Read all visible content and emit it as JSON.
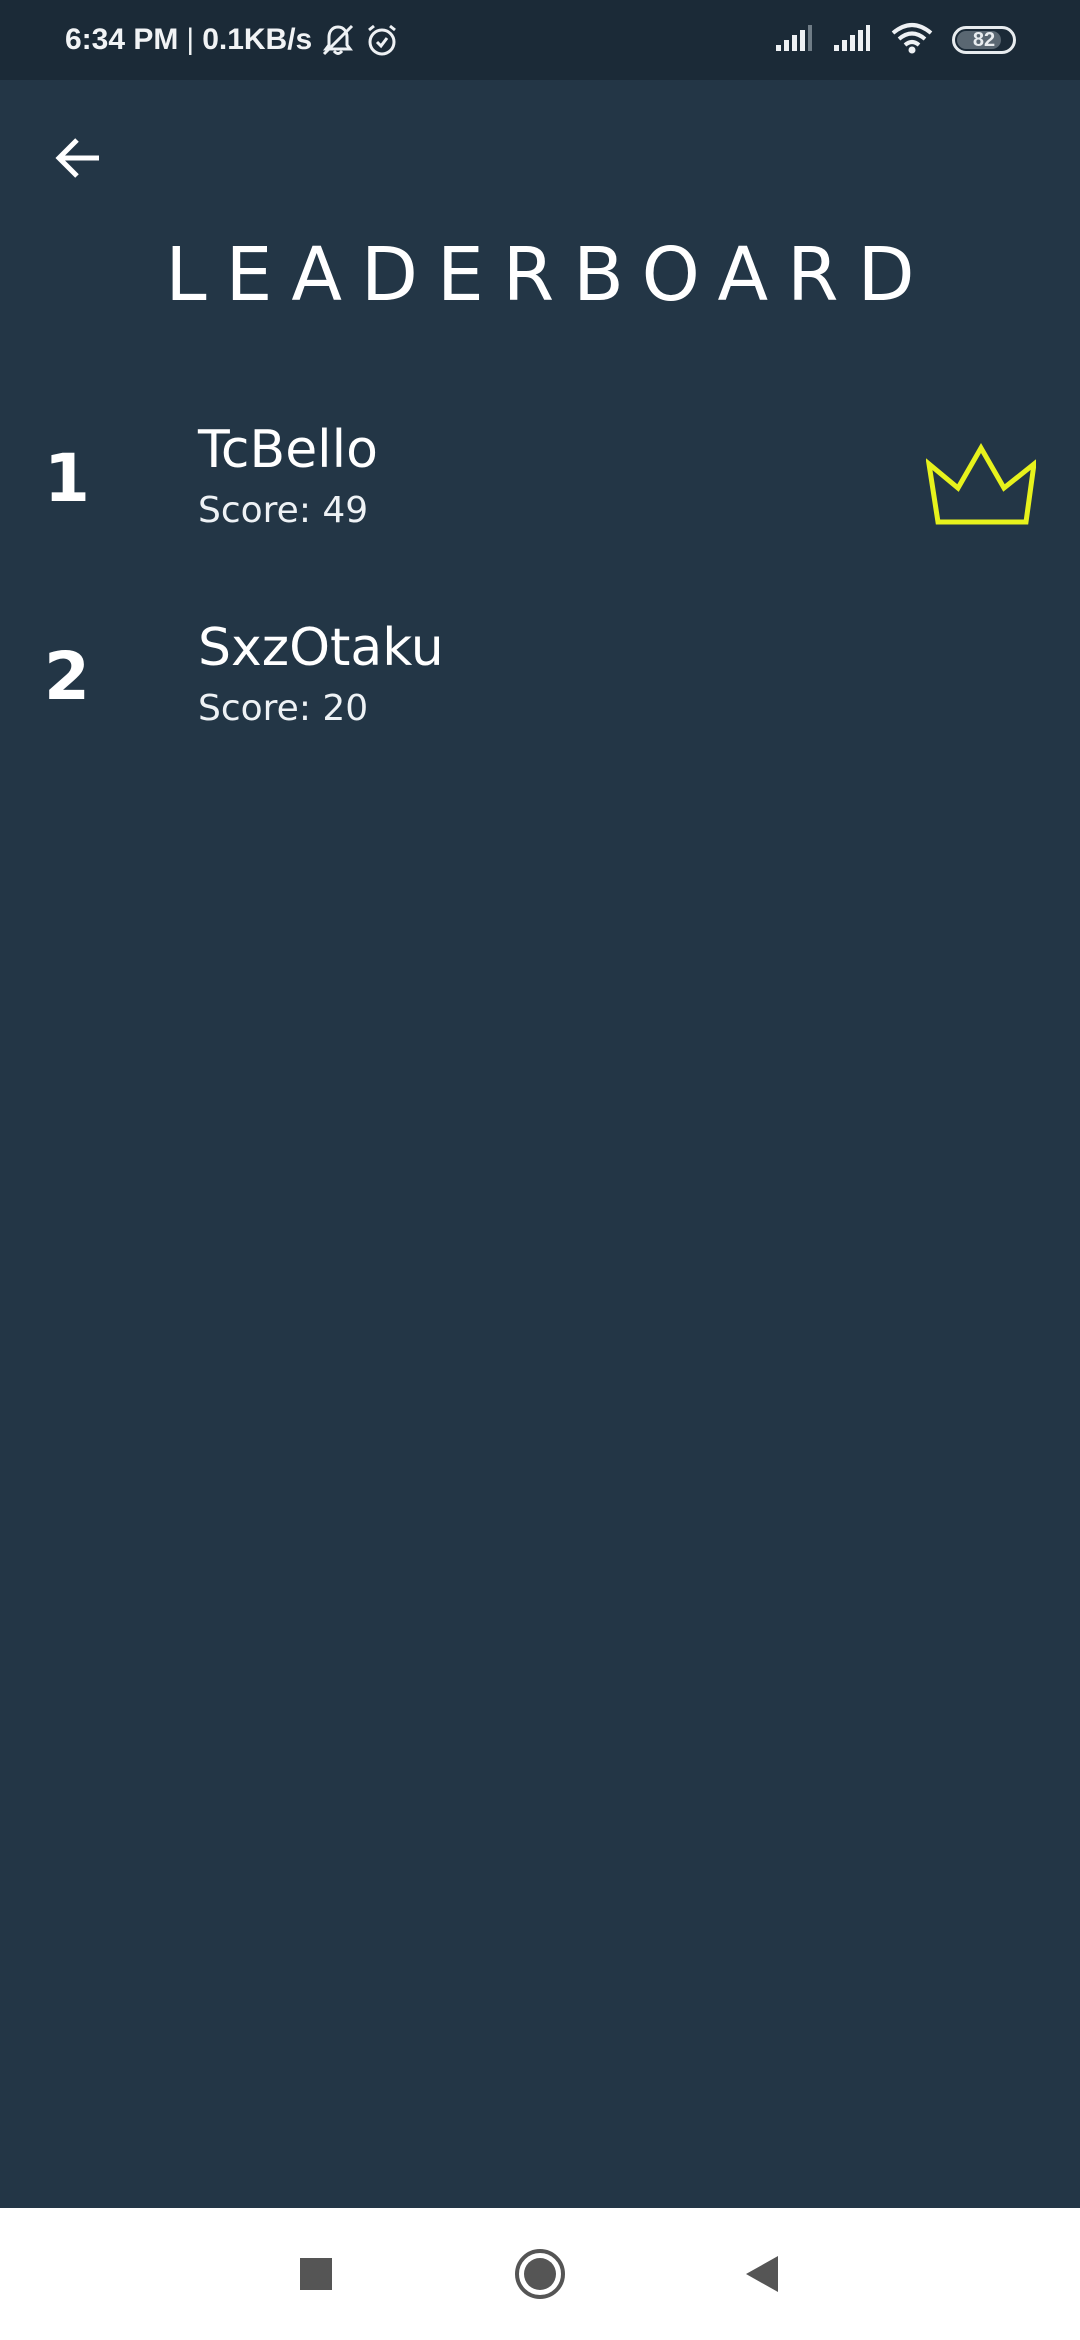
{
  "status_bar": {
    "time": "6:34 PM",
    "separator": "|",
    "network_speed": "0.1KB/s",
    "battery_level": "82",
    "battery_fraction": 0.82,
    "icons": [
      "bell-muted-icon",
      "alarm-icon",
      "signal-icon",
      "signal-icon",
      "wifi-icon",
      "battery-icon"
    ]
  },
  "header": {
    "back_icon": "arrow-left-icon",
    "title": "LEADERBOARD"
  },
  "leaderboard": {
    "entries": [
      {
        "rank": "1",
        "name": "TcBello",
        "score": "Score: 49",
        "badge_icon": "crown-icon"
      },
      {
        "rank": "2",
        "name": "SxzOtaku",
        "score": "Score: 20"
      }
    ]
  },
  "nav_bar": {
    "buttons": [
      "recents-square-icon",
      "home-circle-icon",
      "back-triangle-icon"
    ]
  },
  "colors": {
    "background": "#233646",
    "status_bar": "#1b2a37",
    "text": "#ffffff",
    "crown": "#e7f21c",
    "nav_bar": "#ffffff",
    "nav_icons": "#555555"
  }
}
